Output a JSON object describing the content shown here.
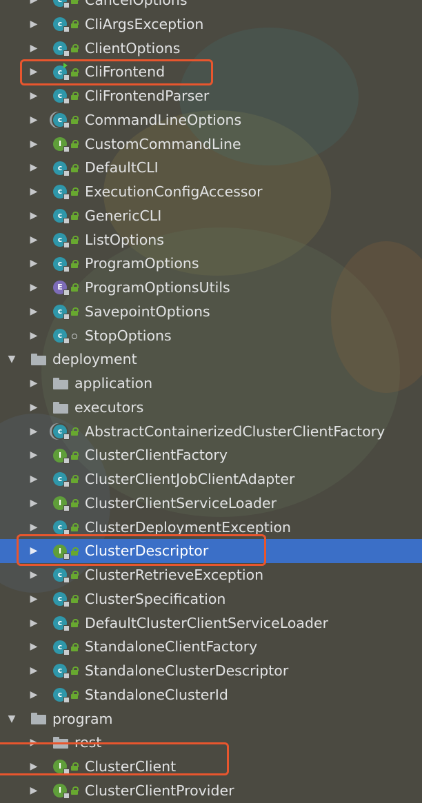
{
  "colors": {
    "background": "#4b4a41",
    "selection": "#3b6fc7",
    "highlight_box": "#e8562e",
    "class_icon": "#2f97aa",
    "interface_icon": "#5f9e3a",
    "enum_icon": "#7d6cb8"
  },
  "tree": {
    "rows": [
      {
        "label": "CancelOptions",
        "icon": "class-icon",
        "visibility": "public"
      },
      {
        "label": "CliArgsException",
        "icon": "class-icon",
        "visibility": "public"
      },
      {
        "label": "ClientOptions",
        "icon": "class-icon",
        "visibility": "public"
      },
      {
        "label": "CliFrontend",
        "icon": "runnable-class-icon",
        "visibility": "public"
      },
      {
        "label": "CliFrontendParser",
        "icon": "class-icon",
        "visibility": "public"
      },
      {
        "label": "CommandLineOptions",
        "icon": "abstract-class-icon",
        "visibility": "public"
      },
      {
        "label": "CustomCommandLine",
        "icon": "interface-icon",
        "visibility": "public"
      },
      {
        "label": "DefaultCLI",
        "icon": "class-icon",
        "visibility": "public"
      },
      {
        "label": "ExecutionConfigAccessor",
        "icon": "class-icon",
        "visibility": "public"
      },
      {
        "label": "GenericCLI",
        "icon": "class-icon",
        "visibility": "public"
      },
      {
        "label": "ListOptions",
        "icon": "class-icon",
        "visibility": "public"
      },
      {
        "label": "ProgramOptions",
        "icon": "class-icon",
        "visibility": "public"
      },
      {
        "label": "ProgramOptionsUtils",
        "icon": "enum-icon",
        "visibility": "public"
      },
      {
        "label": "SavepointOptions",
        "icon": "class-icon",
        "visibility": "public"
      },
      {
        "label": "StopOptions",
        "icon": "class-icon",
        "visibility": "package"
      },
      {
        "label": "deployment",
        "icon": "package-icon",
        "expanded": true
      },
      {
        "label": "application",
        "icon": "package-icon"
      },
      {
        "label": "executors",
        "icon": "package-icon"
      },
      {
        "label": "AbstractContainerizedClusterClientFactory",
        "icon": "abstract-class-icon",
        "visibility": "public"
      },
      {
        "label": "ClusterClientFactory",
        "icon": "interface-icon",
        "visibility": "public"
      },
      {
        "label": "ClusterClientJobClientAdapter",
        "icon": "class-icon",
        "visibility": "public"
      },
      {
        "label": "ClusterClientServiceLoader",
        "icon": "interface-icon",
        "visibility": "public"
      },
      {
        "label": "ClusterDeploymentException",
        "icon": "class-icon",
        "visibility": "public"
      },
      {
        "label": "ClusterDescriptor",
        "icon": "interface-icon",
        "visibility": "public",
        "selected": true
      },
      {
        "label": "ClusterRetrieveException",
        "icon": "class-icon",
        "visibility": "public"
      },
      {
        "label": "ClusterSpecification",
        "icon": "class-icon",
        "visibility": "public"
      },
      {
        "label": "DefaultClusterClientServiceLoader",
        "icon": "class-icon",
        "visibility": "public"
      },
      {
        "label": "StandaloneClientFactory",
        "icon": "class-icon",
        "visibility": "public"
      },
      {
        "label": "StandaloneClusterDescriptor",
        "icon": "class-icon",
        "visibility": "public"
      },
      {
        "label": "StandaloneClusterId",
        "icon": "class-icon",
        "visibility": "public"
      },
      {
        "label": "program",
        "icon": "package-icon",
        "expanded": true
      },
      {
        "label": "rest",
        "icon": "package-icon"
      },
      {
        "label": "ClusterClient",
        "icon": "interface-icon",
        "visibility": "public"
      },
      {
        "label": "ClusterClientProvider",
        "icon": "interface-icon",
        "visibility": "public"
      }
    ]
  }
}
